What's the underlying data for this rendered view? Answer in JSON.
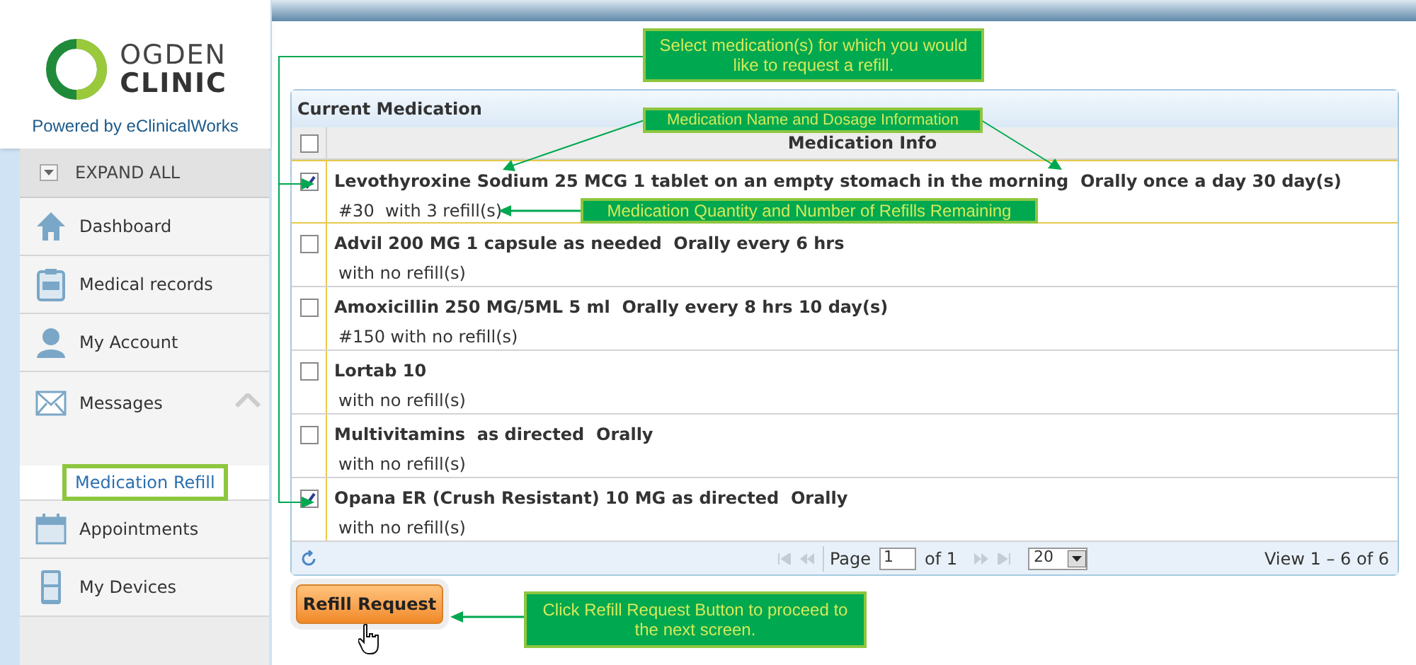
{
  "sidebar": {
    "logo": {
      "line1": "OGDEN",
      "line2": "CLINIC",
      "powered_by": "Powered by eClinicalWorks"
    },
    "expand_all": "EXPAND ALL",
    "items": [
      {
        "label": "Dashboard",
        "expanded": false
      },
      {
        "label": "Medical records",
        "expanded": false
      },
      {
        "label": "My Account",
        "expanded": false
      },
      {
        "label": "Messages",
        "expanded": true,
        "children": [
          {
            "label": "Medication Refill",
            "selected": true
          }
        ]
      },
      {
        "label": "Appointments",
        "expanded": false
      },
      {
        "label": "My Devices",
        "expanded": false
      }
    ]
  },
  "table": {
    "title": "Current Medication",
    "select_all_checked": false,
    "column": "Medication Info",
    "rows": [
      {
        "name": "Levothyroxine Sodium 25 MCG 1 tablet on an empty stomach in the morning  Orally once a day 30 day(s)",
        "detail": "#30  with 3 refill(s)",
        "checked": true,
        "selected": true
      },
      {
        "name": "Advil 200 MG 1 capsule as needed  Orally every 6 hrs",
        "detail": "with no refill(s)",
        "checked": false,
        "selected": false
      },
      {
        "name": "Amoxicillin 250 MG/5ML 5 ml  Orally every 8 hrs 10 day(s)",
        "detail": "#150 with no refill(s)",
        "checked": false,
        "selected": false
      },
      {
        "name": "Lortab 10",
        "detail": "with no refill(s)",
        "checked": false,
        "selected": false
      },
      {
        "name": "Multivitamins  as directed  Orally",
        "detail": "with no refill(s)",
        "checked": false,
        "selected": false
      },
      {
        "name": "Opana ER (Crush Resistant) 10 MG as directed  Orally",
        "detail": "with no refill(s)",
        "checked": true,
        "selected": false
      }
    ],
    "pager": {
      "page_label": "Page",
      "page_value": "1",
      "of_label": "of 1",
      "page_size": "20",
      "view": "View 1 – 6 of 6"
    }
  },
  "refill_button": "Refill Request",
  "callouts": [
    "Select medication(s) for which you would like to request a refill.",
    "Medication Name and Dosage Information",
    "Medication Quantity and Number of Refills Remaining",
    "Click Refill Request Button to proceed to the next screen."
  ]
}
